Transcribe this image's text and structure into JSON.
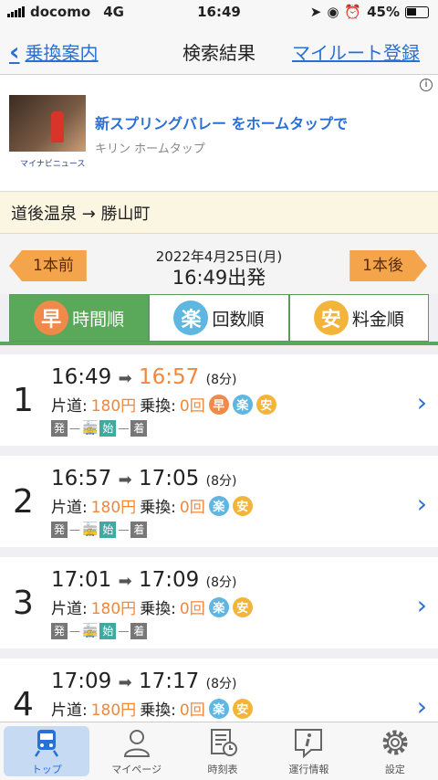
{
  "status": {
    "carrier": "docomo",
    "network": "4G",
    "time": "16:49",
    "battery": "45%"
  },
  "nav": {
    "back": "乗換案内",
    "title": "検索結果",
    "my_route": "マイルート登録"
  },
  "ad": {
    "headline": "新スプリングバレー をホームタップで",
    "advertiser": "キリン ホームタップ",
    "source": "マイナビニュース",
    "info": "i"
  },
  "route": {
    "text": "道後温泉 → 勝山町"
  },
  "timebar": {
    "prev": "1本前",
    "date": "2022年4月25日(月)",
    "depart": "16:49出発",
    "next": "1本後"
  },
  "tabs": [
    {
      "badge": "早",
      "label": "時間順"
    },
    {
      "badge": "楽",
      "label": "回数順"
    },
    {
      "badge": "安",
      "label": "料金順"
    }
  ],
  "results": [
    {
      "num": "1",
      "dep": "16:49",
      "arr": "16:57",
      "dur": "(8分)",
      "fare_label": "片道:",
      "fare": "180円",
      "transfer_label": "乗換:",
      "transfer": "0回",
      "badges": [
        "早",
        "楽",
        "安"
      ]
    },
    {
      "num": "2",
      "dep": "16:57",
      "arr": "17:05",
      "dur": "(8分)",
      "fare_label": "片道:",
      "fare": "180円",
      "transfer_label": "乗換:",
      "transfer": "0回",
      "badges": [
        "楽",
        "安"
      ]
    },
    {
      "num": "3",
      "dep": "17:01",
      "arr": "17:09",
      "dur": "(8分)",
      "fare_label": "片道:",
      "fare": "180円",
      "transfer_label": "乗換:",
      "transfer": "0回",
      "badges": [
        "楽",
        "安"
      ]
    },
    {
      "num": "4",
      "dep": "17:09",
      "arr": "17:17",
      "dur": "(8分)",
      "fare_label": "片道:",
      "fare": "180円",
      "transfer_label": "乗換:",
      "transfer": "0回",
      "badges": [
        "楽",
        "安"
      ]
    }
  ],
  "chain": {
    "dep": "発",
    "start": "始",
    "arr": "着"
  },
  "tabbar": [
    {
      "label": "トップ",
      "icon": "train-icon"
    },
    {
      "label": "マイページ",
      "icon": "person-icon"
    },
    {
      "label": "時刻表",
      "icon": "timetable-icon"
    },
    {
      "label": "運行情報",
      "icon": "info-icon"
    },
    {
      "label": "設定",
      "icon": "gear-icon"
    }
  ]
}
